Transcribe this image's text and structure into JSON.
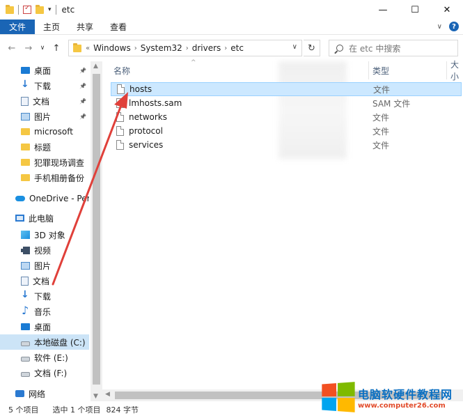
{
  "window": {
    "title": "etc",
    "minimize_label": "—",
    "maximize_label": "☐",
    "close_label": "✕"
  },
  "ribbon": {
    "tabs": [
      "文件",
      "主页",
      "共享",
      "查看"
    ]
  },
  "address": {
    "crumbs": [
      "Windows",
      "System32",
      "drivers",
      "etc"
    ],
    "overflow": "«"
  },
  "search": {
    "placeholder": "在 etc 中搜索"
  },
  "sidebar": {
    "items": [
      {
        "label": "桌面",
        "icon": "desktop-icon",
        "pinned": true
      },
      {
        "label": "下载",
        "icon": "download-icon",
        "pinned": true
      },
      {
        "label": "文档",
        "icon": "document-icon",
        "pinned": true
      },
      {
        "label": "图片",
        "icon": "picture-icon",
        "pinned": true
      },
      {
        "label": "microsoft",
        "icon": "folder-icon"
      },
      {
        "label": "标题",
        "icon": "folder-icon"
      },
      {
        "label": "犯罪现场调查",
        "icon": "folder-icon"
      },
      {
        "label": "手机相册备份",
        "icon": "folder-icon"
      },
      {
        "label": "OneDrive - Pers",
        "icon": "cloud-icon"
      },
      {
        "label": "此电脑",
        "icon": "computer-icon"
      },
      {
        "label": "3D 对象",
        "icon": "3d-objects-icon"
      },
      {
        "label": "视频",
        "icon": "video-icon"
      },
      {
        "label": "图片",
        "icon": "picture-icon"
      },
      {
        "label": "文档",
        "icon": "document-icon"
      },
      {
        "label": "下载",
        "icon": "download-icon"
      },
      {
        "label": "音乐",
        "icon": "music-icon"
      },
      {
        "label": "桌面",
        "icon": "desktop-icon"
      },
      {
        "label": "本地磁盘 (C:)",
        "icon": "drive-icon",
        "selected": true
      },
      {
        "label": "软件 (E:)",
        "icon": "drive-icon"
      },
      {
        "label": "文档 (F:)",
        "icon": "drive-icon"
      },
      {
        "label": "网络",
        "icon": "network-icon"
      }
    ]
  },
  "columns": {
    "name": "名称",
    "type": "类型",
    "size": "大小"
  },
  "files": [
    {
      "name": "hosts",
      "type": "文件",
      "selected": true
    },
    {
      "name": "lmhosts.sam",
      "type": "SAM 文件"
    },
    {
      "name": "networks",
      "type": "文件"
    },
    {
      "name": "protocol",
      "type": "文件"
    },
    {
      "name": "services",
      "type": "文件"
    }
  ],
  "status": {
    "count": "5 个项目",
    "selected": "选中 1 个项目",
    "size": "824 字节"
  },
  "watermark": {
    "title": "电脑软硬件教程网",
    "url": "www.computer26.com"
  },
  "colors": {
    "accent": "#1a65b5",
    "selection": "#cce8ff",
    "arrow": "#e0403a"
  }
}
